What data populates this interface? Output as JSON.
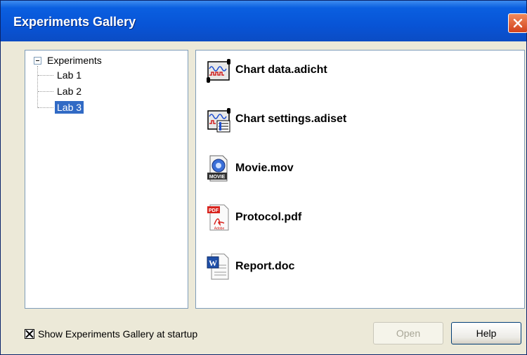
{
  "window": {
    "title": "Experiments Gallery"
  },
  "tree": {
    "root_label": "Experiments",
    "items": [
      {
        "label": "Lab 1",
        "selected": false
      },
      {
        "label": "Lab 2",
        "selected": false
      },
      {
        "label": "Lab 3",
        "selected": true
      }
    ]
  },
  "files": [
    {
      "name": "Chart data.adicht",
      "icon": "chart-data-icon"
    },
    {
      "name": "Chart settings.adiset",
      "icon": "chart-settings-icon"
    },
    {
      "name": "Movie.mov",
      "icon": "quicktime-movie-icon"
    },
    {
      "name": "Protocol.pdf",
      "icon": "pdf-icon"
    },
    {
      "name": "Report.doc",
      "icon": "word-document-icon"
    }
  ],
  "footer": {
    "show_at_startup_label": "Show Experiments Gallery at startup",
    "show_at_startup_checked": true,
    "open_label": "Open",
    "help_label": "Help"
  },
  "colors": {
    "titlebar": "#0854d6",
    "selection": "#316ac5",
    "close_button": "#d2421c"
  }
}
